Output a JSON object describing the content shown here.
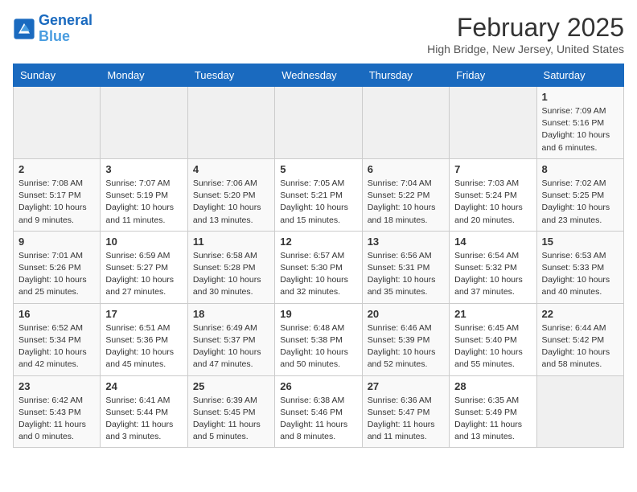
{
  "header": {
    "logo_line1": "General",
    "logo_line2": "Blue",
    "month": "February 2025",
    "location": "High Bridge, New Jersey, United States"
  },
  "days_of_week": [
    "Sunday",
    "Monday",
    "Tuesday",
    "Wednesday",
    "Thursday",
    "Friday",
    "Saturday"
  ],
  "weeks": [
    [
      {
        "num": "",
        "info": ""
      },
      {
        "num": "",
        "info": ""
      },
      {
        "num": "",
        "info": ""
      },
      {
        "num": "",
        "info": ""
      },
      {
        "num": "",
        "info": ""
      },
      {
        "num": "",
        "info": ""
      },
      {
        "num": "1",
        "info": "Sunrise: 7:09 AM\nSunset: 5:16 PM\nDaylight: 10 hours and 6 minutes."
      }
    ],
    [
      {
        "num": "2",
        "info": "Sunrise: 7:08 AM\nSunset: 5:17 PM\nDaylight: 10 hours and 9 minutes."
      },
      {
        "num": "3",
        "info": "Sunrise: 7:07 AM\nSunset: 5:19 PM\nDaylight: 10 hours and 11 minutes."
      },
      {
        "num": "4",
        "info": "Sunrise: 7:06 AM\nSunset: 5:20 PM\nDaylight: 10 hours and 13 minutes."
      },
      {
        "num": "5",
        "info": "Sunrise: 7:05 AM\nSunset: 5:21 PM\nDaylight: 10 hours and 15 minutes."
      },
      {
        "num": "6",
        "info": "Sunrise: 7:04 AM\nSunset: 5:22 PM\nDaylight: 10 hours and 18 minutes."
      },
      {
        "num": "7",
        "info": "Sunrise: 7:03 AM\nSunset: 5:24 PM\nDaylight: 10 hours and 20 minutes."
      },
      {
        "num": "8",
        "info": "Sunrise: 7:02 AM\nSunset: 5:25 PM\nDaylight: 10 hours and 23 minutes."
      }
    ],
    [
      {
        "num": "9",
        "info": "Sunrise: 7:01 AM\nSunset: 5:26 PM\nDaylight: 10 hours and 25 minutes."
      },
      {
        "num": "10",
        "info": "Sunrise: 6:59 AM\nSunset: 5:27 PM\nDaylight: 10 hours and 27 minutes."
      },
      {
        "num": "11",
        "info": "Sunrise: 6:58 AM\nSunset: 5:28 PM\nDaylight: 10 hours and 30 minutes."
      },
      {
        "num": "12",
        "info": "Sunrise: 6:57 AM\nSunset: 5:30 PM\nDaylight: 10 hours and 32 minutes."
      },
      {
        "num": "13",
        "info": "Sunrise: 6:56 AM\nSunset: 5:31 PM\nDaylight: 10 hours and 35 minutes."
      },
      {
        "num": "14",
        "info": "Sunrise: 6:54 AM\nSunset: 5:32 PM\nDaylight: 10 hours and 37 minutes."
      },
      {
        "num": "15",
        "info": "Sunrise: 6:53 AM\nSunset: 5:33 PM\nDaylight: 10 hours and 40 minutes."
      }
    ],
    [
      {
        "num": "16",
        "info": "Sunrise: 6:52 AM\nSunset: 5:34 PM\nDaylight: 10 hours and 42 minutes."
      },
      {
        "num": "17",
        "info": "Sunrise: 6:51 AM\nSunset: 5:36 PM\nDaylight: 10 hours and 45 minutes."
      },
      {
        "num": "18",
        "info": "Sunrise: 6:49 AM\nSunset: 5:37 PM\nDaylight: 10 hours and 47 minutes."
      },
      {
        "num": "19",
        "info": "Sunrise: 6:48 AM\nSunset: 5:38 PM\nDaylight: 10 hours and 50 minutes."
      },
      {
        "num": "20",
        "info": "Sunrise: 6:46 AM\nSunset: 5:39 PM\nDaylight: 10 hours and 52 minutes."
      },
      {
        "num": "21",
        "info": "Sunrise: 6:45 AM\nSunset: 5:40 PM\nDaylight: 10 hours and 55 minutes."
      },
      {
        "num": "22",
        "info": "Sunrise: 6:44 AM\nSunset: 5:42 PM\nDaylight: 10 hours and 58 minutes."
      }
    ],
    [
      {
        "num": "23",
        "info": "Sunrise: 6:42 AM\nSunset: 5:43 PM\nDaylight: 11 hours and 0 minutes."
      },
      {
        "num": "24",
        "info": "Sunrise: 6:41 AM\nSunset: 5:44 PM\nDaylight: 11 hours and 3 minutes."
      },
      {
        "num": "25",
        "info": "Sunrise: 6:39 AM\nSunset: 5:45 PM\nDaylight: 11 hours and 5 minutes."
      },
      {
        "num": "26",
        "info": "Sunrise: 6:38 AM\nSunset: 5:46 PM\nDaylight: 11 hours and 8 minutes."
      },
      {
        "num": "27",
        "info": "Sunrise: 6:36 AM\nSunset: 5:47 PM\nDaylight: 11 hours and 11 minutes."
      },
      {
        "num": "28",
        "info": "Sunrise: 6:35 AM\nSunset: 5:49 PM\nDaylight: 11 hours and 13 minutes."
      },
      {
        "num": "",
        "info": ""
      }
    ]
  ]
}
